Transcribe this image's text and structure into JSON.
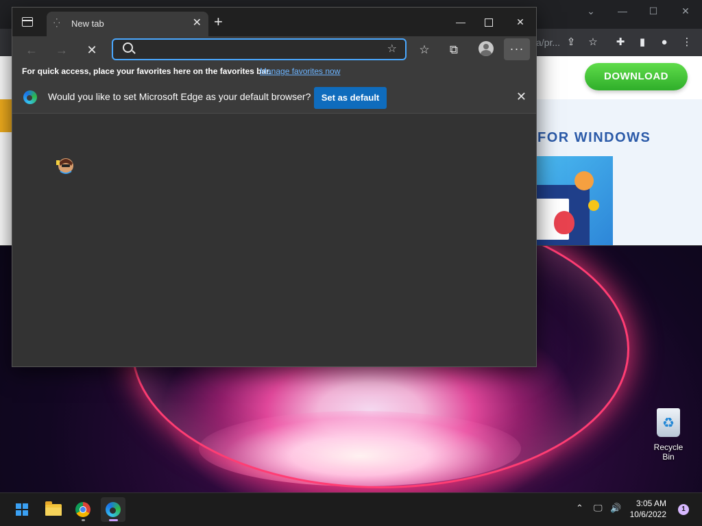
{
  "edge": {
    "tab_title": "New tab",
    "tab_close": "✕",
    "new_tab": "+",
    "address_placeholder": "",
    "address_value": "",
    "fav_bar_text": "For quick access, place your favorites here on the favorites bar.",
    "fav_bar_link": "Manage favorites now",
    "infobar_text": "Would you like to set Microsoft Edge as your default browser?",
    "set_default_label": "Set as default",
    "more_label": "···"
  },
  "chrome_page": {
    "download_label": "DOWNLOAD",
    "promo_text": "FOR WINDOWS",
    "url_fragment": "a/pr..."
  },
  "desktop": {
    "recycle_bin_label": "Recycle Bin"
  },
  "taskbar": {
    "time": "3:05 AM",
    "date": "10/6/2022",
    "notification_count": "1"
  },
  "colors": {
    "edge_accent": "#4aa8ff",
    "set_default_bg": "#0f6cbd",
    "download_green": "#3cc236"
  }
}
